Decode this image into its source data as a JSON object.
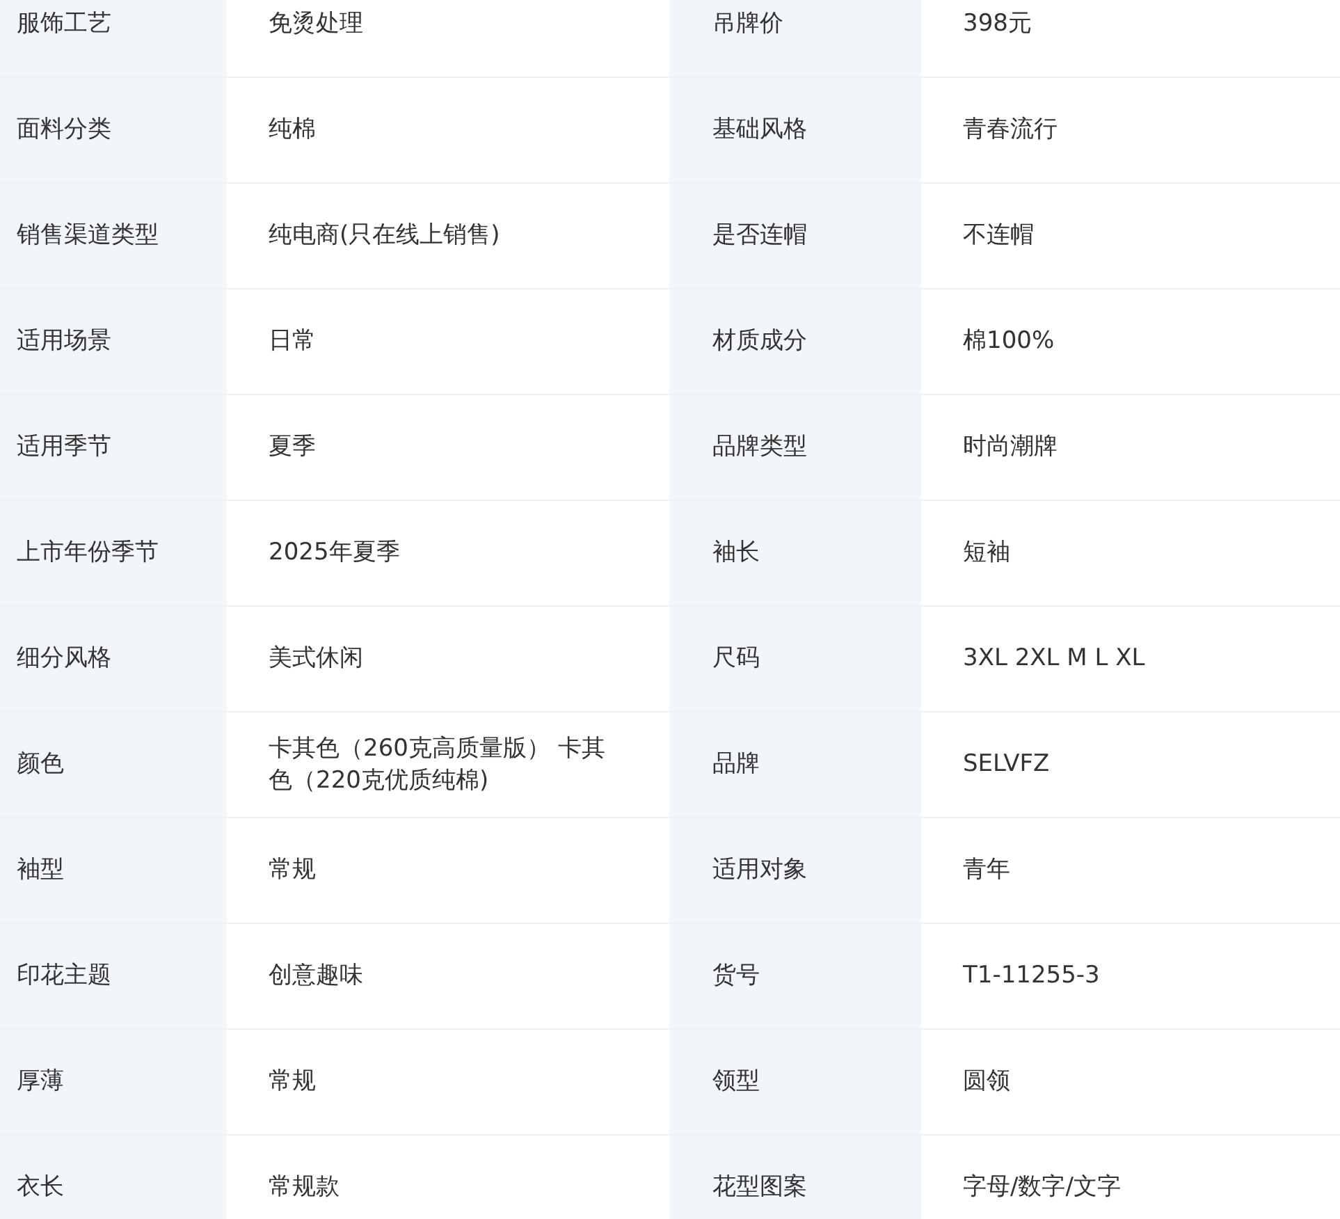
{
  "rows": [
    {
      "label_1": "服饰工艺",
      "value_1": "免烫处理",
      "label_2": "吊牌价",
      "value_2": "398元"
    },
    {
      "label_1": "面料分类",
      "value_1": "纯棉",
      "label_2": "基础风格",
      "value_2": "青春流行"
    },
    {
      "label_1": "销售渠道类型",
      "value_1": "纯电商(只在线上销售)",
      "label_2": "是否连帽",
      "value_2": "不连帽"
    },
    {
      "label_1": "适用场景",
      "value_1": "日常",
      "label_2": "材质成分",
      "value_2": "棉100%"
    },
    {
      "label_1": "适用季节",
      "value_1": "夏季",
      "label_2": "品牌类型",
      "value_2": "时尚潮牌"
    },
    {
      "label_1": "上市年份季节",
      "value_1": "2025年夏季",
      "label_2": "袖长",
      "value_2": "短袖"
    },
    {
      "label_1": "细分风格",
      "value_1": "美式休闲",
      "label_2": "尺码",
      "value_2": "3XL 2XL M L XL"
    },
    {
      "label_1": "颜色",
      "value_1": "卡其色（260克高质量版） 卡其色（220克优质纯棉)",
      "label_2": "品牌",
      "value_2": "SELVFZ"
    },
    {
      "label_1": "袖型",
      "value_1": "常规",
      "label_2": "适用对象",
      "value_2": "青年"
    },
    {
      "label_1": "印花主题",
      "value_1": "创意趣味",
      "label_2": "货号",
      "value_2": "T1-11255-3"
    },
    {
      "label_1": "厚薄",
      "value_1": "常规",
      "label_2": "领型",
      "value_2": "圆领"
    },
    {
      "label_1": "衣长",
      "value_1": "常规款",
      "label_2": "花型图案",
      "value_2": "字母/数字/文字"
    }
  ]
}
